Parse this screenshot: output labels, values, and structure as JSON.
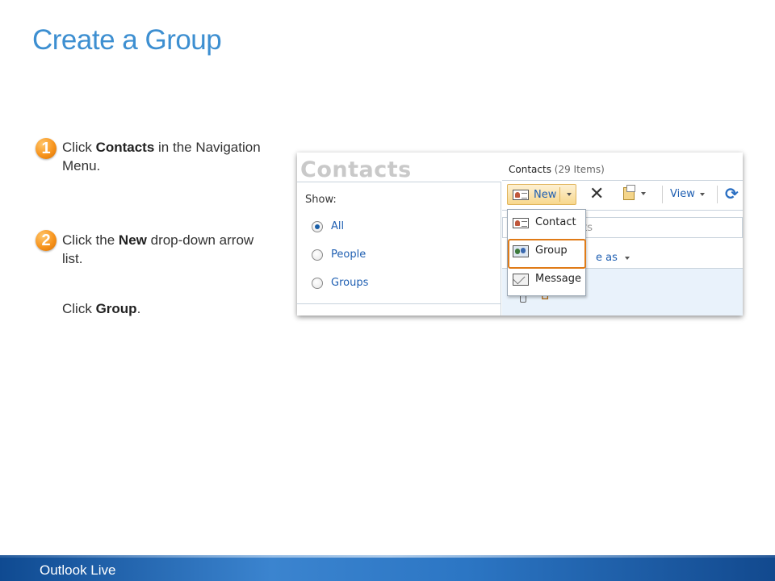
{
  "slide": {
    "title": "Create a Group",
    "footer": "Outlook Live"
  },
  "steps": [
    {
      "number": "1",
      "parts": [
        {
          "text": "Click ",
          "bold": false
        },
        {
          "text": "Contacts",
          "bold": true
        },
        {
          "text": " in the Navigation Menu.",
          "bold": false
        }
      ]
    },
    {
      "number": "2",
      "parts": [
        {
          "text": "Click the ",
          "bold": false
        },
        {
          "text": "New",
          "bold": true
        },
        {
          "text": " drop-down arrow list.",
          "bold": false
        }
      ],
      "followup": [
        {
          "text": "Click ",
          "bold": false
        },
        {
          "text": "Group",
          "bold": true
        },
        {
          "text": ".",
          "bold": false
        }
      ]
    }
  ],
  "screenshot": {
    "heading": "Contacts",
    "show_label": "Show:",
    "filters": [
      {
        "label": "All",
        "checked": true
      },
      {
        "label": "People",
        "checked": false
      },
      {
        "label": "Groups",
        "checked": false
      }
    ],
    "list_title": "Contacts",
    "item_count": "(29 Items)",
    "toolbar": {
      "new_label": "New",
      "view_label": "View"
    },
    "search_text": "cts",
    "arrange_text": "e as",
    "new_menu": [
      {
        "label": "Contact",
        "icon": "contact-card-icon"
      },
      {
        "label": "Group",
        "icon": "group-icon",
        "highlighted": true
      },
      {
        "label": "Message",
        "icon": "message-icon"
      }
    ]
  },
  "colors": {
    "title": "#3d8fd1",
    "step_badge": "#f7941d",
    "highlight": "#e07b17",
    "footer_bar": "#2c76c4"
  }
}
